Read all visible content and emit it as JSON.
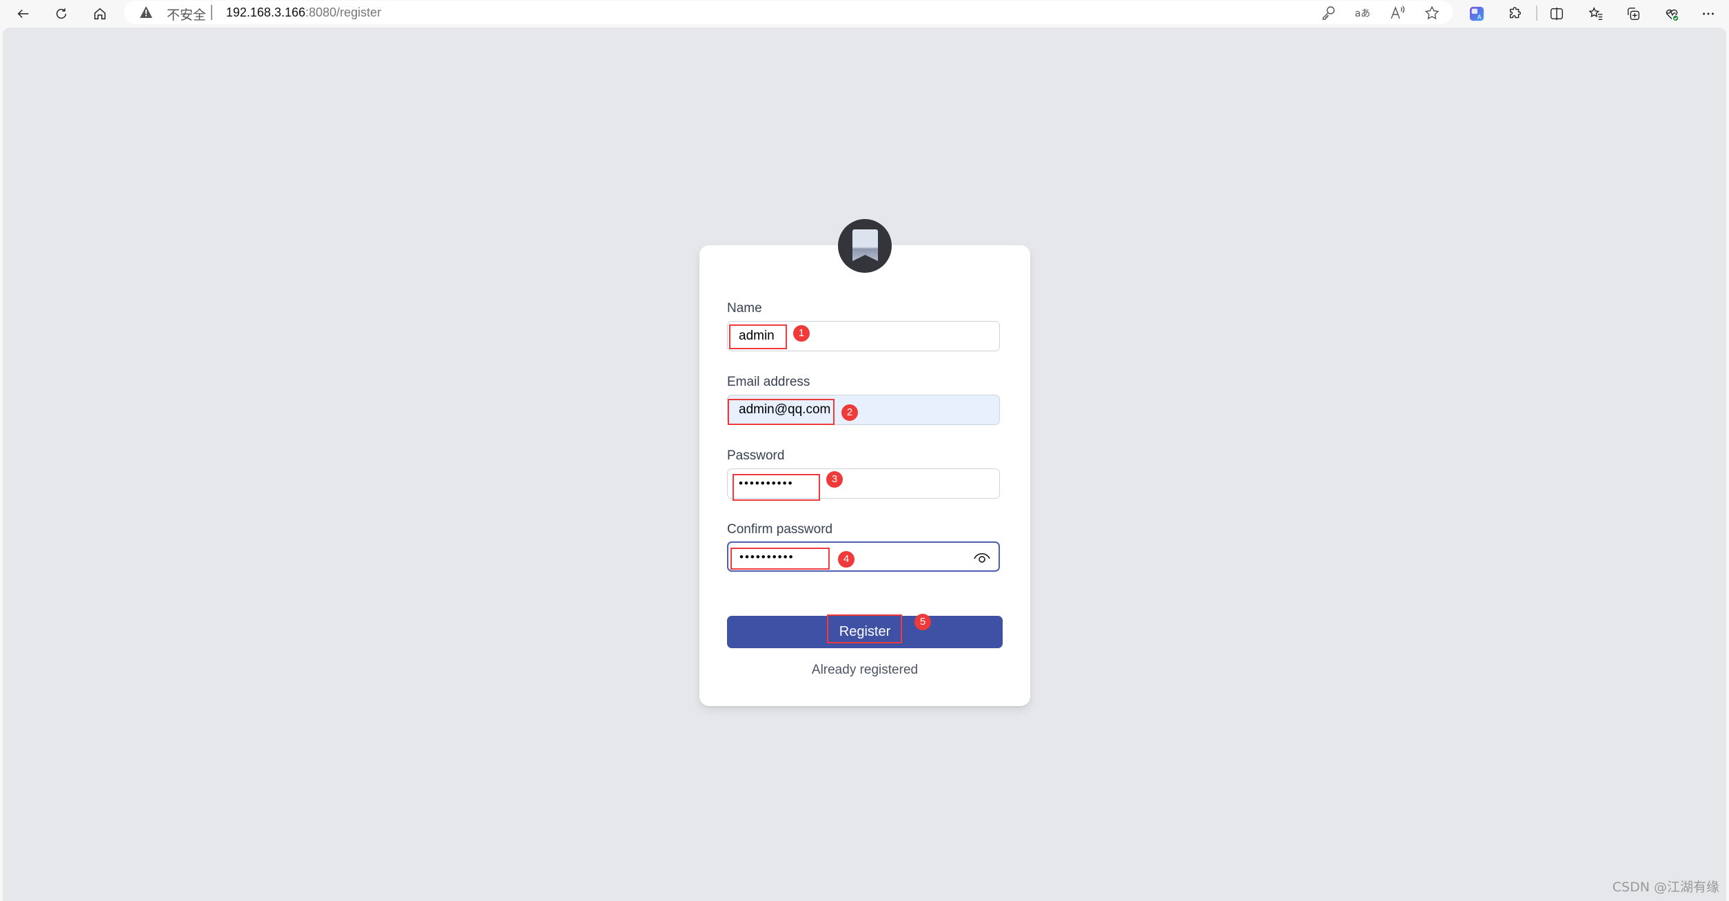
{
  "browser": {
    "security_label": "不安全",
    "url_host": "192.168.3.166",
    "url_rest": ":8080/register",
    "icons": {
      "nav": [
        "back-icon",
        "refresh-icon",
        "home-icon"
      ],
      "address_bar": [
        "password-key-icon",
        "translate-icon",
        "read-aloud-icon",
        "favorite-star-icon"
      ],
      "toolbar": [
        "translator-extension-icon",
        "extensions-icon",
        "split-screen-icon",
        "favorites-icon",
        "collections-icon",
        "browser-essentials-icon",
        "more-icon"
      ]
    }
  },
  "form": {
    "fields": [
      {
        "label": "Name",
        "value": "admin",
        "type": "text"
      },
      {
        "label": "Email address",
        "value": "admin@qq.com",
        "type": "email"
      },
      {
        "label": "Password",
        "value": "••••••••••",
        "type": "password"
      },
      {
        "label": "Confirm password",
        "value": "••••••••••",
        "type": "password"
      }
    ],
    "submit_label": "Register",
    "login_link": "Already registered"
  },
  "annotations": [
    "1",
    "2",
    "3",
    "4",
    "5"
  ],
  "colors": {
    "primary": "#3f51a5",
    "annotation": "#ee3a3a",
    "background": "#e5e7eb",
    "focus_border": "#4c5fb0",
    "autofill_bg": "#e8f0fe"
  },
  "watermark": "CSDN @江湖有缘"
}
